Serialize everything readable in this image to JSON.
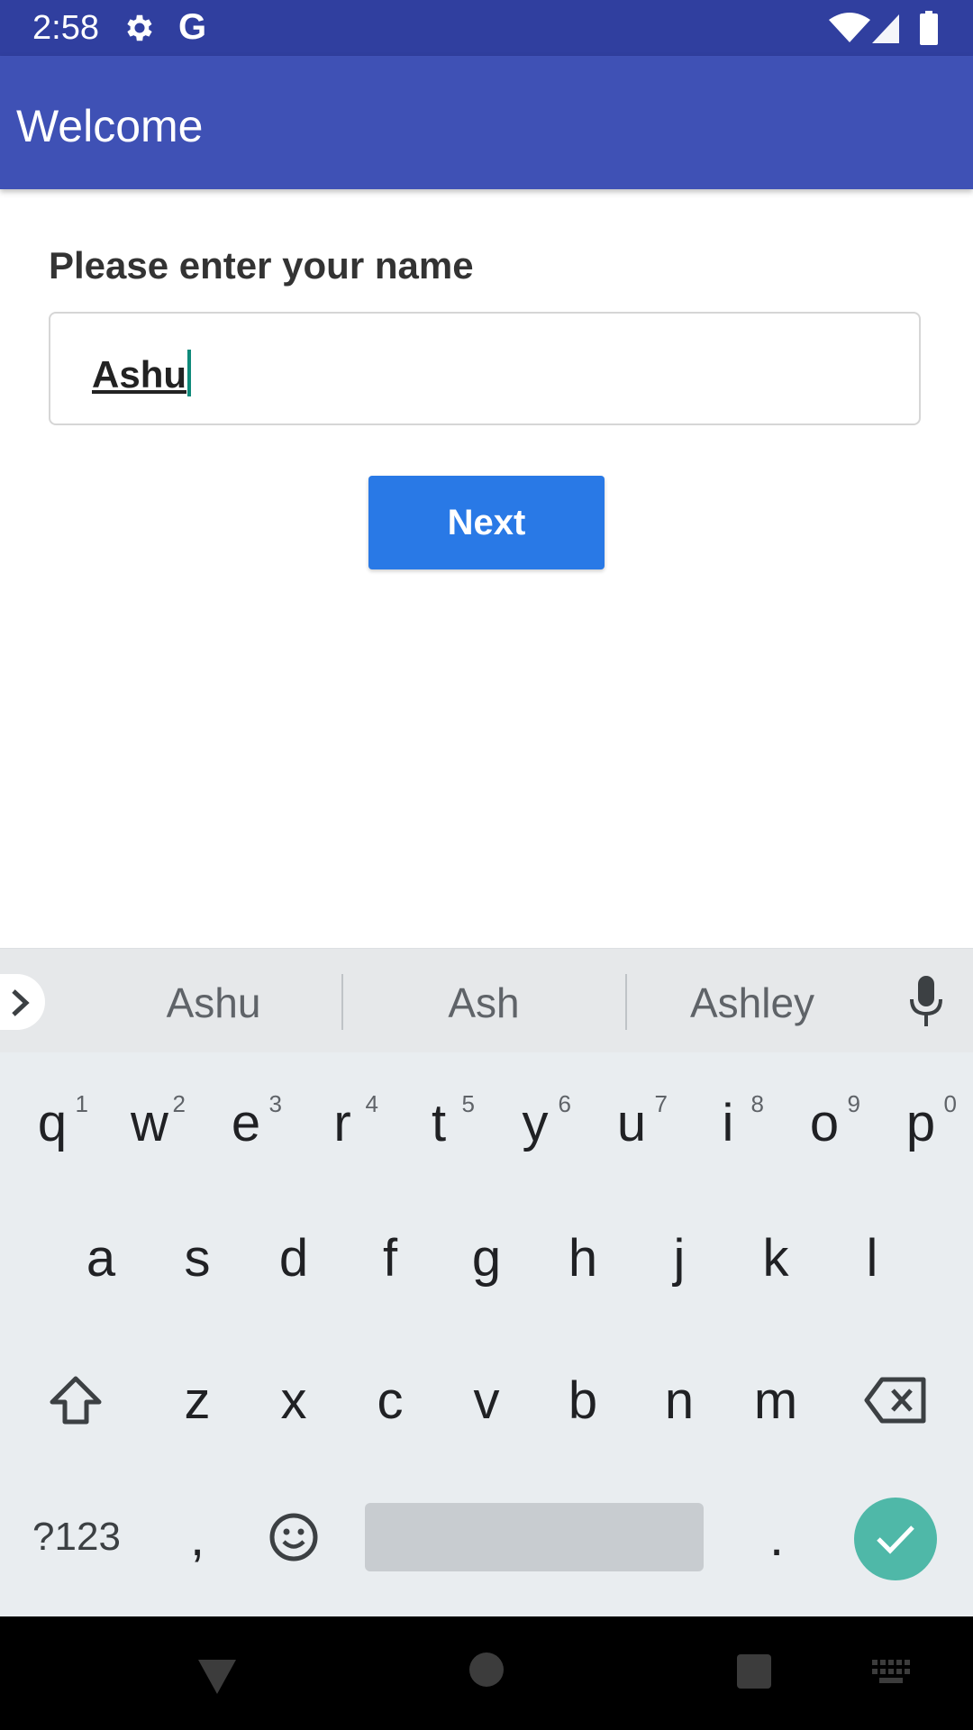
{
  "status_bar": {
    "time": "2:58",
    "icons": [
      "settings-gear-icon",
      "google-g-icon",
      "wifi-icon",
      "cell-signal-icon",
      "battery-icon"
    ],
    "g_glyph": "G"
  },
  "app_bar": {
    "title": "Welcome",
    "color": "#3F51B5",
    "status_color": "#303F9F"
  },
  "form": {
    "prompt": "Please enter your name",
    "name_value": "Ashu",
    "next_label": "Next",
    "button_color": "#2979E6"
  },
  "keyboard": {
    "suggestions": [
      "Ashu",
      "Ash",
      "Ashley"
    ],
    "row1": [
      {
        "l": "q",
        "n": "1"
      },
      {
        "l": "w",
        "n": "2"
      },
      {
        "l": "e",
        "n": "3"
      },
      {
        "l": "r",
        "n": "4"
      },
      {
        "l": "t",
        "n": "5"
      },
      {
        "l": "y",
        "n": "6"
      },
      {
        "l": "u",
        "n": "7"
      },
      {
        "l": "i",
        "n": "8"
      },
      {
        "l": "o",
        "n": "9"
      },
      {
        "l": "p",
        "n": "0"
      }
    ],
    "row2": [
      "a",
      "s",
      "d",
      "f",
      "g",
      "h",
      "j",
      "k",
      "l"
    ],
    "row3": [
      "z",
      "x",
      "c",
      "v",
      "b",
      "n",
      "m"
    ],
    "symbols_label": "?123",
    "comma": ",",
    "period": ".",
    "enter_color": "#4fb8a8"
  },
  "nav_bar": {
    "icons": [
      "back-triangle-icon",
      "home-circle-icon",
      "recents-square-icon",
      "keyboard-switch-icon"
    ]
  }
}
